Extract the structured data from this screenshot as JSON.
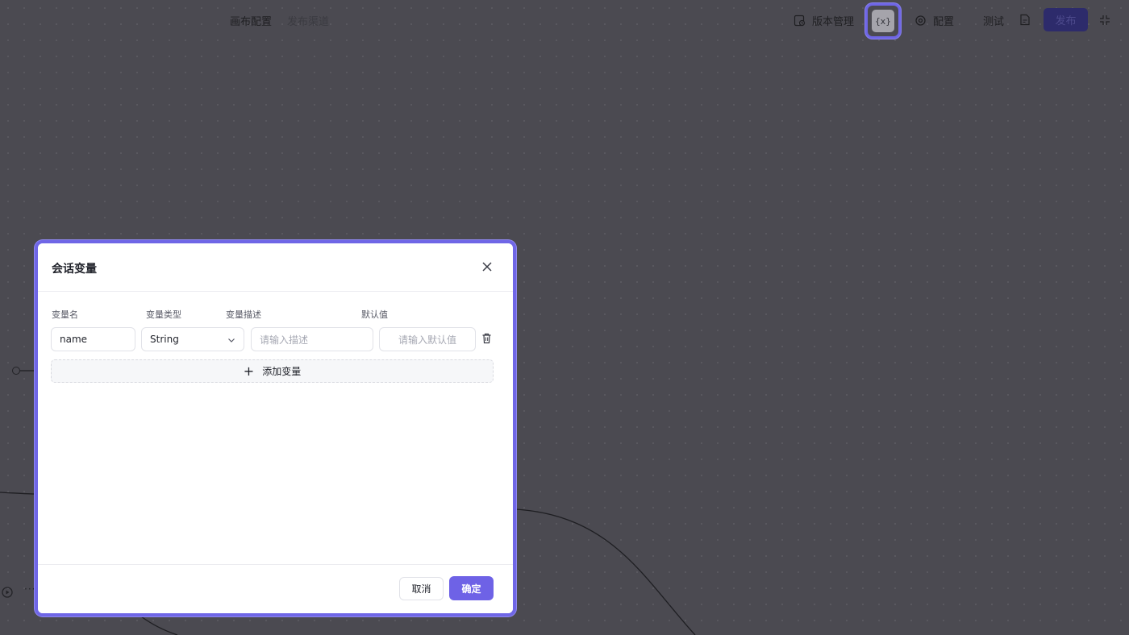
{
  "header": {
    "tabs": [
      {
        "label": "画布配置",
        "active": true
      },
      {
        "label": "发布渠道",
        "active": false
      }
    ],
    "version_label": "版本管理",
    "variables_label": "{x}",
    "config_label": "配置",
    "test_label": "测试",
    "publish_label": "发布"
  },
  "modal": {
    "title": "会话变量",
    "columns": {
      "name": "变量名",
      "type": "变量类型",
      "description": "变量描述",
      "default": "默认值"
    },
    "variables": [
      {
        "name": "name",
        "type": "String",
        "description_placeholder": "请输入描述",
        "default_placeholder": "请输入默认值"
      }
    ],
    "add_label": "添加变量",
    "cancel_label": "取消",
    "confirm_label": "确定"
  },
  "colors": {
    "accent": "#6e62e6",
    "canvas": "#4b4a51",
    "publish_bg": "#2d2b6b"
  },
  "icons": [
    "version-icon",
    "variables-icon",
    "gear-icon",
    "doc-icon",
    "collapse-icon",
    "close-icon",
    "chevron-down-icon",
    "trash-icon",
    "plus-icon",
    "play-icon"
  ]
}
